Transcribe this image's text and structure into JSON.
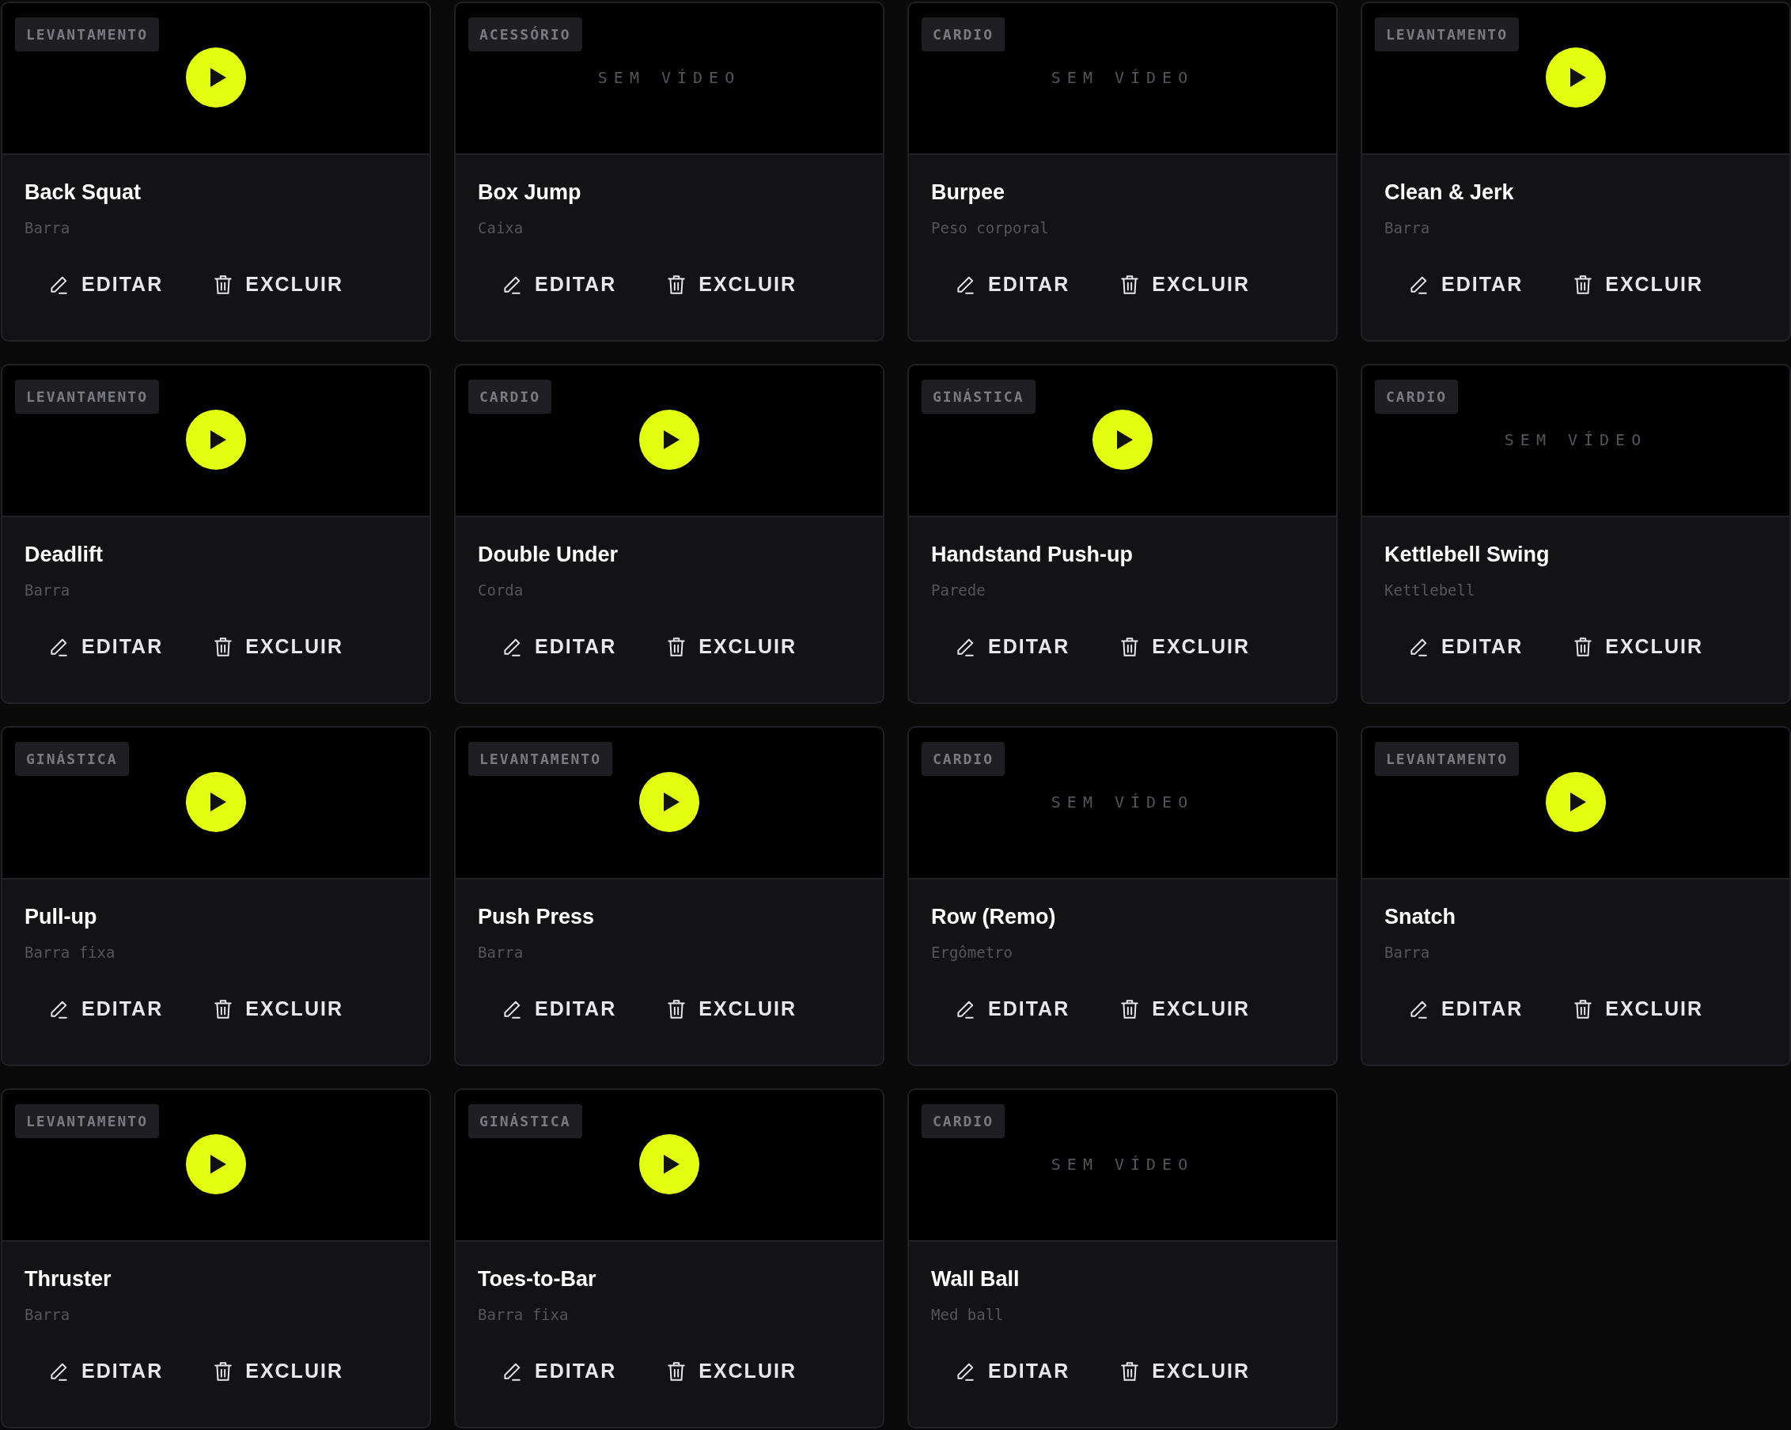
{
  "exercises": [
    {
      "category": "LEVANTAMENTO",
      "media": {
        "kind": "video"
      },
      "name": "Back Squat",
      "equipment": "Barra",
      "edit": "EDITAR",
      "delete": "EXCLUIR"
    },
    {
      "category": "ACESSÓRIO",
      "media": {
        "kind": "empty",
        "label": "SEM VÍDEO"
      },
      "name": "Box Jump",
      "equipment": "Caixa",
      "edit": "EDITAR",
      "delete": "EXCLUIR"
    },
    {
      "category": "CARDIO",
      "media": {
        "kind": "empty",
        "label": "SEM VÍDEO"
      },
      "name": "Burpee",
      "equipment": "Peso corporal",
      "edit": "EDITAR",
      "delete": "EXCLUIR"
    },
    {
      "category": "LEVANTAMENTO",
      "media": {
        "kind": "video"
      },
      "name": "Clean & Jerk",
      "equipment": "Barra",
      "edit": "EDITAR",
      "delete": "EXCLUIR"
    },
    {
      "category": "LEVANTAMENTO",
      "media": {
        "kind": "video"
      },
      "name": "Deadlift",
      "equipment": "Barra",
      "edit": "EDITAR",
      "delete": "EXCLUIR"
    },
    {
      "category": "CARDIO",
      "media": {
        "kind": "video"
      },
      "name": "Double Under",
      "equipment": "Corda",
      "edit": "EDITAR",
      "delete": "EXCLUIR"
    },
    {
      "category": "GINÁSTICA",
      "media": {
        "kind": "video"
      },
      "name": "Handstand Push-up",
      "equipment": "Parede",
      "edit": "EDITAR",
      "delete": "EXCLUIR"
    },
    {
      "category": "CARDIO",
      "media": {
        "kind": "empty",
        "label": "SEM VÍDEO"
      },
      "name": "Kettlebell Swing",
      "equipment": "Kettlebell",
      "edit": "EDITAR",
      "delete": "EXCLUIR"
    },
    {
      "category": "GINÁSTICA",
      "media": {
        "kind": "video"
      },
      "name": "Pull-up",
      "equipment": "Barra fixa",
      "edit": "EDITAR",
      "delete": "EXCLUIR"
    },
    {
      "category": "LEVANTAMENTO",
      "media": {
        "kind": "video"
      },
      "name": "Push Press",
      "equipment": "Barra",
      "edit": "EDITAR",
      "delete": "EXCLUIR"
    },
    {
      "category": "CARDIO",
      "media": {
        "kind": "empty",
        "label": "SEM VÍDEO"
      },
      "name": "Row (Remo)",
      "equipment": "Ergômetro",
      "edit": "EDITAR",
      "delete": "EXCLUIR"
    },
    {
      "category": "LEVANTAMENTO",
      "media": {
        "kind": "video"
      },
      "name": "Snatch",
      "equipment": "Barra",
      "edit": "EDITAR",
      "delete": "EXCLUIR"
    },
    {
      "category": "LEVANTAMENTO",
      "media": {
        "kind": "video"
      },
      "name": "Thruster",
      "equipment": "Barra",
      "edit": "EDITAR",
      "delete": "EXCLUIR"
    },
    {
      "category": "GINÁSTICA",
      "media": {
        "kind": "video"
      },
      "name": "Toes-to-Bar",
      "equipment": "Barra fixa",
      "edit": "EDITAR",
      "delete": "EXCLUIR"
    },
    {
      "category": "CARDIO",
      "media": {
        "kind": "empty",
        "label": "SEM VÍDEO"
      },
      "name": "Wall Ball",
      "equipment": "Med ball",
      "edit": "EDITAR",
      "delete": "EXCLUIR"
    }
  ]
}
